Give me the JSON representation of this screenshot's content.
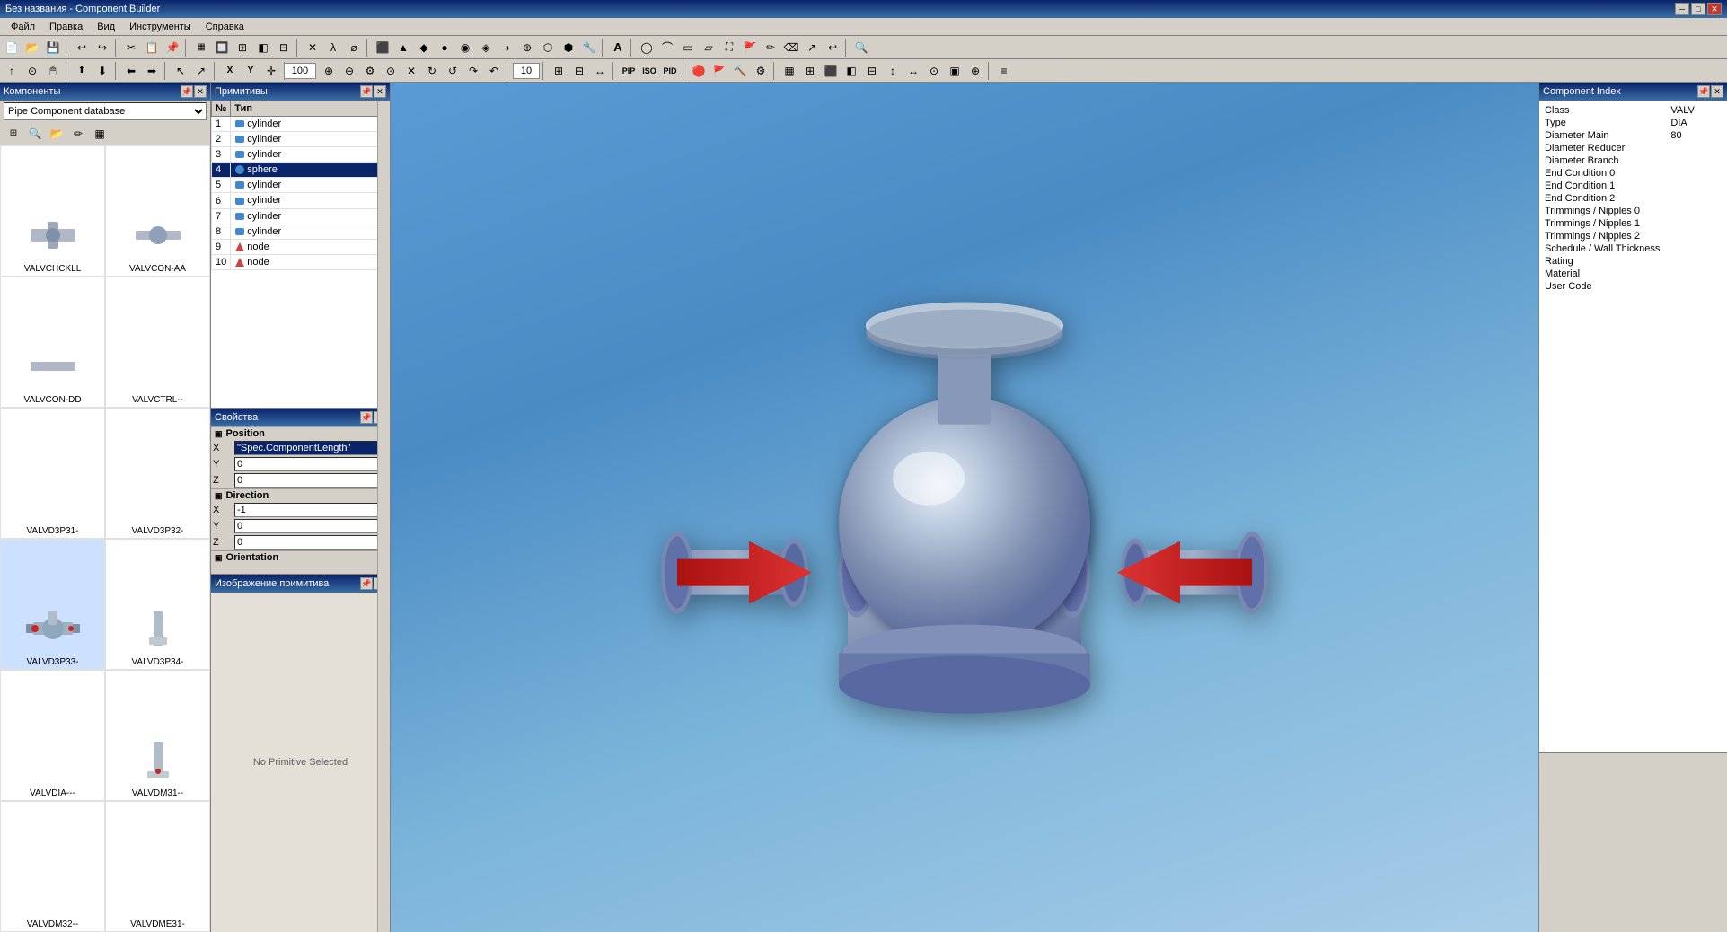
{
  "titlebar": {
    "title": "Без названия - Component Builder",
    "minimize": "🗕",
    "maximize": "🗗",
    "close": "✕"
  },
  "menu": {
    "items": [
      "Файл",
      "Правка",
      "Вид",
      "Инструменты",
      "Справка"
    ]
  },
  "panels": {
    "components_label": "Компоненты",
    "primitives_label": "Примитивы",
    "properties_label": "Свойства",
    "prim_image_label": "Изображение примитива",
    "component_index_label": "Component Index"
  },
  "components": {
    "database": "Pipe Component database",
    "items": [
      {
        "label": "VALVCHCKLL",
        "has_icon": false
      },
      {
        "label": "VALVCON-AA",
        "has_icon": false
      },
      {
        "label": "VALVCON-DD",
        "has_icon": false
      },
      {
        "label": "VALVCTRL--",
        "has_icon": false
      },
      {
        "label": "VALVD3P31-",
        "has_icon": false
      },
      {
        "label": "VALVD3P32-",
        "has_icon": false
      },
      {
        "label": "VALVD3P33-",
        "has_icon": true
      },
      {
        "label": "VALVD3P34-",
        "has_icon": true
      },
      {
        "label": "VALVDIA---",
        "has_icon": false
      },
      {
        "label": "VALVDM31--",
        "has_icon": true
      },
      {
        "label": "VALVDM32--",
        "has_icon": false
      },
      {
        "label": "VALVDME31-",
        "has_icon": false
      }
    ]
  },
  "primitives": {
    "columns": [
      "№",
      "Тип"
    ],
    "rows": [
      {
        "num": "1",
        "type": "cylinder",
        "icon": "cylinder",
        "selected": false
      },
      {
        "num": "2",
        "type": "cylinder",
        "icon": "cylinder",
        "selected": false
      },
      {
        "num": "3",
        "type": "cylinder",
        "icon": "cylinder",
        "selected": false
      },
      {
        "num": "4",
        "type": "sphere",
        "icon": "sphere",
        "selected": true
      },
      {
        "num": "5",
        "type": "cylinder",
        "icon": "cylinder",
        "selected": false
      },
      {
        "num": "6",
        "type": "cylinder",
        "icon": "cylinder",
        "selected": false
      },
      {
        "num": "7",
        "type": "cylinder",
        "icon": "cylinder",
        "selected": false
      },
      {
        "num": "8",
        "type": "cylinder",
        "icon": "cylinder",
        "selected": false
      },
      {
        "num": "9",
        "type": "node",
        "icon": "node",
        "selected": false
      },
      {
        "num": "10",
        "type": "node",
        "icon": "node",
        "selected": false
      }
    ]
  },
  "properties": {
    "position_label": "Position",
    "direction_label": "Direction",
    "orientation_label": "Orientation",
    "x_label": "X",
    "y_label": "Y",
    "z_label": "Z",
    "position_x": "\"Spec.ComponentLength\"",
    "position_y": "0",
    "position_z": "0",
    "direction_x": "-1",
    "direction_y": "0",
    "direction_z": "0"
  },
  "prim_image": {
    "no_primitive": "No Primitive Selected"
  },
  "component_index": {
    "fields": [
      {
        "label": "Class",
        "value": "VALV"
      },
      {
        "label": "Type",
        "value": "DIA"
      },
      {
        "label": "Diameter Main",
        "value": "80"
      },
      {
        "label": "Diameter Reducer",
        "value": ""
      },
      {
        "label": "Diameter Branch",
        "value": ""
      },
      {
        "label": "End Condition 0",
        "value": ""
      },
      {
        "label": "End Condition 1",
        "value": ""
      },
      {
        "label": "End Condition 2",
        "value": ""
      },
      {
        "label": "Trimmings / Nipples 0",
        "value": ""
      },
      {
        "label": "Trimmings / Nipples 1",
        "value": ""
      },
      {
        "label": "Trimmings / Nipples 2",
        "value": ""
      },
      {
        "label": "Schedule / Wall Thickness",
        "value": ""
      },
      {
        "label": "Rating",
        "value": ""
      },
      {
        "label": "Material",
        "value": ""
      },
      {
        "label": "User Code",
        "value": ""
      }
    ]
  },
  "toolbar1_zoom": "100",
  "toolbar2_val": "10"
}
